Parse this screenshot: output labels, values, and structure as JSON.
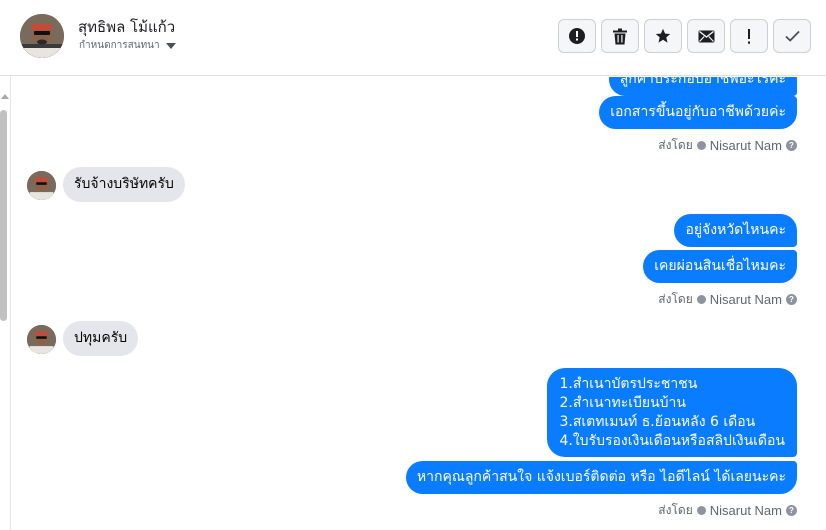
{
  "header": {
    "contact_name": "สุทธิพล โม้แก้ว",
    "nickname_label": "กำหนดการสนทนา",
    "tools": [
      {
        "icon": "alert-circle-icon",
        "name": "spam-button"
      },
      {
        "icon": "trash-icon",
        "name": "delete-button"
      },
      {
        "icon": "star-icon",
        "name": "star-button"
      },
      {
        "icon": "envelope-icon",
        "name": "mark-unread-button"
      },
      {
        "icon": "exclamation-icon",
        "name": "follow-up-button"
      },
      {
        "icon": "check-icon",
        "name": "done-button"
      }
    ]
  },
  "messages": {
    "out_1_partial": "ลูกค้าประกอบอาชีพอะไรคะ",
    "out_2": "เอกสารขึ้นอยู่กับอาชีพด้วยค่ะ",
    "sent_by_1": {
      "prefix": "ส่งโดย",
      "agent": "Nisarut Nam"
    },
    "in_1": "รับจ้างบริษัทครับ",
    "out_3": "อยู่จังหวัดไหนคะ",
    "out_4": "เคยผ่อนสินเชื่อไหมคะ",
    "sent_by_2": {
      "prefix": "ส่งโดย",
      "agent": "Nisarut Nam"
    },
    "in_2": "ปทุมครับ",
    "out_5_lines": [
      "1.สำเนาบัตรประชาชน",
      "2.สำเนาทะเบียนบ้าน",
      "3.สเตทเมนท์ ธ.ย้อนหลัง 6 เดือน",
      "4.ใบรับรองเงินเดือนหรือสลิปเงินเดือน"
    ],
    "out_6": "หากคุณลูกค้าสนใจ แจ้งเบอร์ติดต่อ หรือ ไอดีไลน์ ได้เลยนะคะ",
    "sent_by_3": {
      "prefix": "ส่งโดย",
      "agent": "Nisarut Nam"
    }
  },
  "colors": {
    "outgoing_bubble": "#0a7cff",
    "incoming_bubble": "#e4e6eb"
  }
}
